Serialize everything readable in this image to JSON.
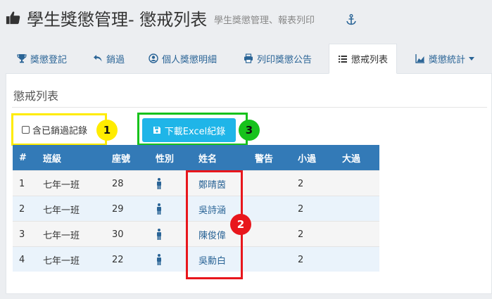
{
  "header": {
    "title": "學生獎懲管理- 懲戒列表",
    "subtitle": "學生獎懲管理、報表列印"
  },
  "tabs": [
    {
      "label": "獎懲登記",
      "icon": "trophy-icon"
    },
    {
      "label": "銷過",
      "icon": "undo-icon"
    },
    {
      "label": "個人獎懲明細",
      "icon": "user-circle-icon"
    },
    {
      "label": "列印獎懲公告",
      "icon": "print-icon"
    },
    {
      "label": "懲戒列表",
      "icon": "list-icon",
      "active": true
    },
    {
      "label": "獎懲統計",
      "icon": "chart-icon",
      "dropdown": true
    }
  ],
  "panel": {
    "title": "懲戒列表",
    "include_cancelled_label": "含已銷過記錄",
    "download_label": "下載Excel紀錄"
  },
  "callouts": [
    "1",
    "2",
    "3"
  ],
  "table": {
    "headers": [
      "#",
      "班級",
      "座號",
      "性別",
      "姓名",
      "警告",
      "小過",
      "大過"
    ],
    "rows": [
      {
        "idx": "1",
        "class": "七年一班",
        "seat": "28",
        "gender": "male",
        "name": "鄭晴茵",
        "warn": "",
        "minor": "2",
        "major": ""
      },
      {
        "idx": "2",
        "class": "七年一班",
        "seat": "29",
        "gender": "male",
        "name": "吳詩涵",
        "warn": "",
        "minor": "2",
        "major": ""
      },
      {
        "idx": "3",
        "class": "七年一班",
        "seat": "30",
        "gender": "male",
        "name": "陳俊偉",
        "warn": "",
        "minor": "2",
        "major": ""
      },
      {
        "idx": "4",
        "class": "七年一班",
        "seat": "22",
        "gender": "male",
        "name": "吳勳白",
        "warn": "",
        "minor": "2",
        "major": ""
      }
    ]
  },
  "colors": {
    "accent": "#337ab7",
    "link": "#2a6496",
    "download_button": "#1fb5e8",
    "callout_1": "#ffec00",
    "callout_2": "#e8161c",
    "callout_3": "#17c21c"
  }
}
